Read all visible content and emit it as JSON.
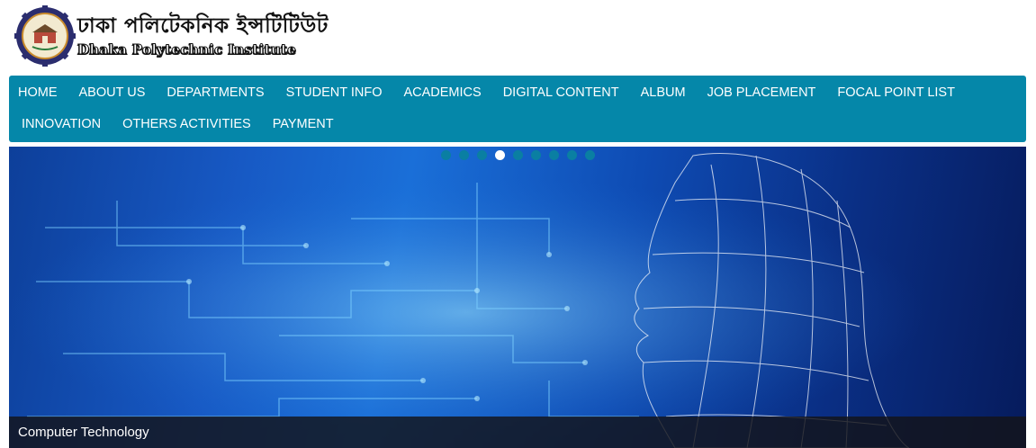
{
  "header": {
    "logo_bn": "ঢাকা পলিটেকনিক ইন্সটিটিউট",
    "logo_en": "Dhaka Polytechnic Institute"
  },
  "nav": {
    "items": [
      {
        "label": "HOME"
      },
      {
        "label": "ABOUT US"
      },
      {
        "label": "DEPARTMENTS"
      },
      {
        "label": "STUDENT INFO"
      },
      {
        "label": "ACADEMICS"
      },
      {
        "label": "DIGITAL CONTENT"
      },
      {
        "label": "ALBUM"
      },
      {
        "label": "JOB PLACEMENT"
      },
      {
        "label": "FOCAL POINT LIST"
      },
      {
        "label": "INNOVATION"
      },
      {
        "label": "OTHERS ACTIVITIES"
      },
      {
        "label": "PAYMENT"
      }
    ],
    "color": "#0587a9"
  },
  "slider": {
    "caption": "Computer Technology",
    "dot_count": 9,
    "active_dot": 3
  }
}
